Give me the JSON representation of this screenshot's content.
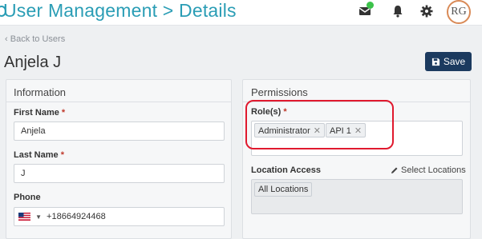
{
  "header": {
    "title": "User Management > Details",
    "avatar_initials": "RG"
  },
  "nav": {
    "back_label": "Back to Users"
  },
  "user": {
    "name": "Anjela J"
  },
  "toolbar": {
    "save_label": "Save"
  },
  "information": {
    "title": "Information",
    "first_name_label": "First Name",
    "first_name_value": "Anjela",
    "last_name_label": "Last Name",
    "last_name_value": "J",
    "phone_label": "Phone",
    "phone_value": "+18664924468"
  },
  "permissions": {
    "title": "Permissions",
    "roles_label": "Role(s)",
    "roles": [
      "Administrator",
      "API 1"
    ],
    "location_label": "Location Access",
    "select_locations_label": "Select Locations",
    "location_value": "All Locations"
  },
  "required_marker": "*",
  "colors": {
    "accent": "#2a9db5",
    "save_button": "#1b3a5f",
    "highlight": "#e0192e",
    "notification": "#3cc24a"
  }
}
